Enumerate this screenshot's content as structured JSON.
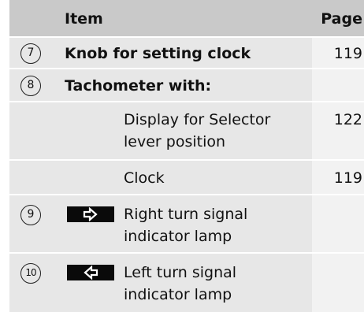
{
  "header": {
    "item": "Item",
    "page": "Page"
  },
  "rows": [
    {
      "num": "7",
      "label": "Knob for setting clock",
      "page": "119"
    },
    {
      "num": "8",
      "label": "Tachometer with:"
    },
    {
      "sub": [
        "Display for Selector",
        "lever position"
      ],
      "page": "122"
    },
    {
      "sub": [
        "Clock"
      ],
      "page": "119"
    },
    {
      "num": "9",
      "icon": "right-turn-signal-icon",
      "sub": [
        "Right turn signal",
        "indicator lamp"
      ]
    },
    {
      "num": "10",
      "icon": "left-turn-signal-icon",
      "sub": [
        "Left turn signal",
        "indicator lamp"
      ]
    }
  ]
}
